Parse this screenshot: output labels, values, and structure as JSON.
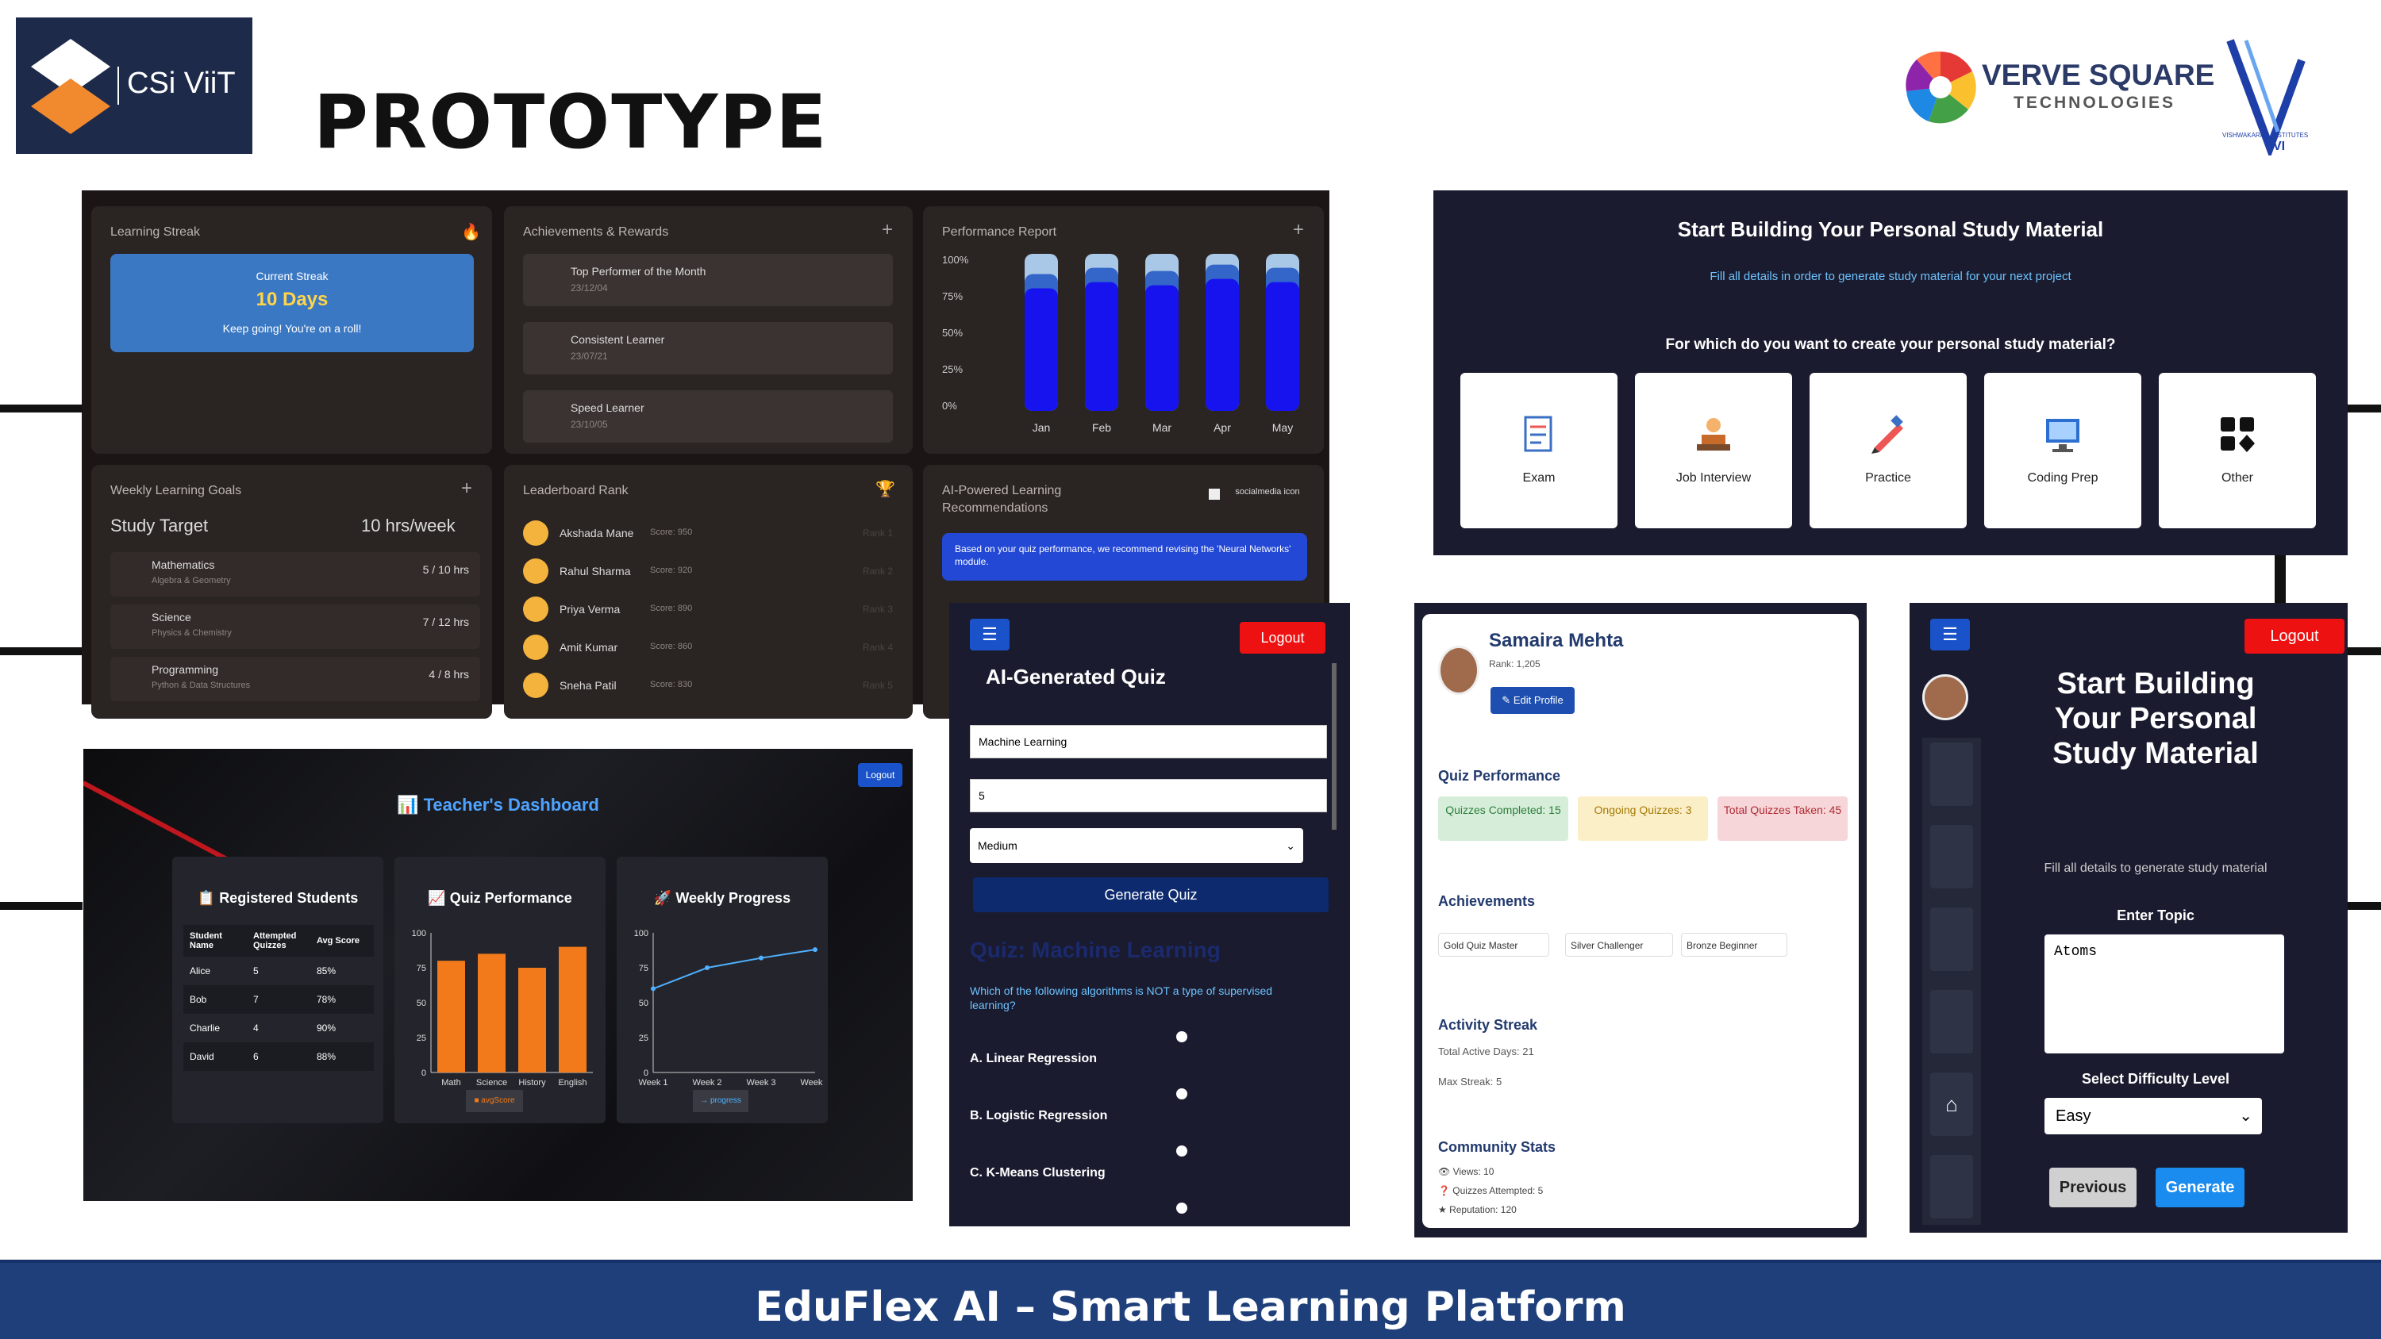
{
  "header": {
    "title": "PROTOTYPE",
    "logo_text": "CSi ViiT",
    "partner1_name": "VERVE SQUARE",
    "partner1_sub": "TECHNOLOGIES",
    "partner2_text": "VISHWAKARMA INSTITUTES",
    "partner2_short": "VI"
  },
  "dashboard": {
    "streak": {
      "title": "Learning Streak",
      "label": "Current Streak",
      "value": "10 Days",
      "msg": "Keep going! You're on a roll!"
    },
    "achievements": {
      "title": "Achievements & Rewards",
      "items": [
        {
          "name": "Top Performer of the Month",
          "date": "23/12/04"
        },
        {
          "name": "Consistent Learner",
          "date": "23/07/21"
        },
        {
          "name": "Speed Learner",
          "date": "23/10/05"
        }
      ]
    },
    "performance": {
      "title": "Performance Report",
      "yticks": [
        "100%",
        "75%",
        "50%",
        "25%",
        "0%"
      ]
    },
    "goals": {
      "title": "Weekly Learning Goals",
      "target_label": "Study Target",
      "target_value": "10 hrs/week",
      "items": [
        {
          "name": "Mathematics",
          "sub": "Algebra & Geometry",
          "val": "5 / 10 hrs"
        },
        {
          "name": "Science",
          "sub": "Physics & Chemistry",
          "val": "7 / 12 hrs"
        },
        {
          "name": "Programming",
          "sub": "Python & Data Structures",
          "val": "4 / 8 hrs"
        }
      ]
    },
    "leaderboard": {
      "title": "Leaderboard Rank",
      "rows": [
        {
          "name": "Akshada Mane",
          "score": "Score: 950",
          "rank": "Rank 1"
        },
        {
          "name": "Rahul Sharma",
          "score": "Score: 920",
          "rank": "Rank 2"
        },
        {
          "name": "Priya Verma",
          "score": "Score: 890",
          "rank": "Rank 3"
        },
        {
          "name": "Amit Kumar",
          "score": "Score: 860",
          "rank": "Rank 4"
        },
        {
          "name": "Sneha Patil",
          "score": "Score: 830",
          "rank": "Rank 5"
        }
      ]
    },
    "ai": {
      "title1": "AI-Powered Learning",
      "title2": "Recommendations",
      "icon_label": "socialmedia icon",
      "msg": "Based on your quiz performance, we recommend revising the 'Neural Networks' module."
    }
  },
  "perf_chart": {
    "type": "bar",
    "categories": [
      "Jan",
      "Feb",
      "Mar",
      "Apr",
      "May"
    ],
    "values": [
      78,
      82,
      80,
      84,
      82
    ],
    "ylim": [
      0,
      100
    ]
  },
  "study": {
    "title": "Start Building Your Personal Study Material",
    "sub": "Fill all details in order to generate study material for your next project",
    "question": "For which do you want to create your personal study material?",
    "tiles": [
      "Exam",
      "Job Interview",
      "Practice",
      "Coding Prep",
      "Other"
    ]
  },
  "teacher": {
    "logout": "Logout",
    "title": "Teacher's Dashboard",
    "students": {
      "title": "Registered Students",
      "headers": [
        "Student Name",
        "Attempted Quizzes",
        "Avg Score"
      ],
      "rows": [
        [
          "Alice",
          "5",
          "85%"
        ],
        [
          "Bob",
          "7",
          "78%"
        ],
        [
          "Charlie",
          "4",
          "90%"
        ],
        [
          "David",
          "6",
          "88%"
        ]
      ]
    },
    "quiz_title": "Quiz Performance",
    "quiz_legend": "avgScore",
    "weekly_title": "Weekly Progress",
    "weekly_legend": "progress"
  },
  "chart_data": [
    {
      "type": "bar",
      "title": "Quiz Performance",
      "categories": [
        "Math",
        "Science",
        "History",
        "English"
      ],
      "values": [
        80,
        85,
        75,
        90
      ],
      "ylim": [
        0,
        100
      ],
      "yticks": [
        "100",
        "75",
        "50",
        "25",
        "0"
      ],
      "legend": "avgScore"
    },
    {
      "type": "line",
      "title": "Weekly Progress",
      "categories": [
        "Week 1",
        "Week 2",
        "Week 3",
        "Week 4"
      ],
      "values": [
        60,
        75,
        82,
        88
      ],
      "ylim": [
        0,
        100
      ],
      "yticks": [
        "100",
        "75",
        "50",
        "25",
        "0"
      ],
      "legend": "progress"
    }
  ],
  "quiz": {
    "logout": "Logout",
    "title": "AI-Generated Quiz",
    "topic": "Machine Learning",
    "count": "5",
    "difficulty": "Medium",
    "generate": "Generate Quiz",
    "heading": "Quiz: Machine Learning",
    "question": "Which of the following algorithms is NOT a type of supervised learning?",
    "options": [
      "A. Linear Regression",
      "B. Logistic Regression",
      "C. K-Means Clustering"
    ]
  },
  "profile": {
    "name": "Samaira Mehta",
    "rank": "Rank: 1,205",
    "edit": "Edit Profile",
    "perf_title": "Quiz Performance",
    "completed": "Quizzes Completed: 15",
    "ongoing": "Ongoing Quizzes: 3",
    "taken": "Total Quizzes Taken: 45",
    "ach_title": "Achievements",
    "badges": [
      "Gold Quiz Master",
      "Silver Challenger",
      "Bronze Beginner"
    ],
    "streak_title": "Activity Streak",
    "active": "Total Active Days: 21",
    "max": "Max Streak: 5",
    "comm_title": "Community Stats",
    "views": "Views: 10",
    "attempted": "Quizzes Attempted: 5",
    "rep": "Reputation: 120"
  },
  "mobile": {
    "logout": "Logout",
    "title": "Start Building Your Personal Study Material",
    "sub": "Fill all details to generate study material",
    "topic_label": "Enter Topic",
    "topic": "Atoms",
    "diff_label": "Select Difficulty Level",
    "diff": "Easy",
    "prev": "Previous",
    "gen": "Generate"
  },
  "footer": {
    "text": "EduFlex AI – Smart Learning Platform"
  }
}
